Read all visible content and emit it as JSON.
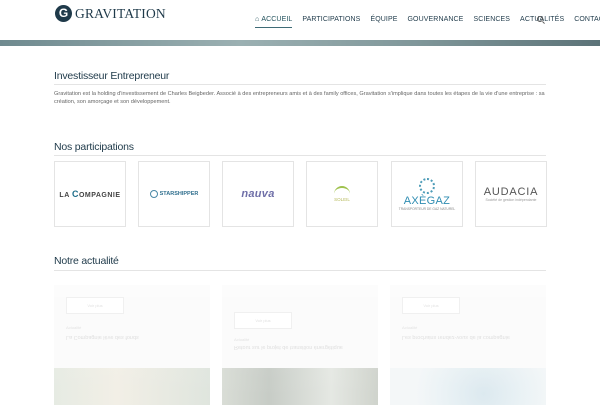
{
  "brand": {
    "logo_letter": "G",
    "name": "GRAVITATION"
  },
  "nav": {
    "items": [
      {
        "label": "ACCUEIL",
        "active": true
      },
      {
        "label": "PARTICIPATIONS"
      },
      {
        "label": "ÉQUIPE"
      },
      {
        "label": "GOUVERNANCE"
      },
      {
        "label": "SCIENCES"
      },
      {
        "label": "ACTUALITÉS"
      },
      {
        "label": "CONTACT"
      }
    ]
  },
  "intro": {
    "title": "Investisseur Entrepreneur",
    "text": "Gravitation est la holding d'investissement de Charles Beigbeder. Associé à des entrepreneurs amis et à des family offices, Gravitation s'implique dans toutes les étapes de la vie d'une entreprise : sa création, son amorçage et son développement."
  },
  "participations": {
    "title": "Nos participations",
    "partners": [
      {
        "name": "LA COMPAGNIE",
        "prefix": "LA ",
        "big": "C",
        "rest": "OMPAGNIE"
      },
      {
        "name": "STARSHIPPER"
      },
      {
        "name": "nauva"
      },
      {
        "name": "SOLEIL"
      },
      {
        "name": "AXÈGAZ",
        "sub": "TRANSPORTEUR DE GAZ NATUREL"
      },
      {
        "name": "AUDACIA",
        "sub": "Société de gestion indépendante"
      }
    ]
  },
  "news": {
    "title": "Notre actualité",
    "badge": "Voir plus",
    "items": [
      {
        "meta": "Actualité",
        "title": "La Compagnie lève des fonds"
      },
      {
        "meta": "Actualité",
        "title": "Retour sur le projet de transition énergétique"
      },
      {
        "meta": "Actualité",
        "title": "Les prochains rendez-vous de la compagnie"
      }
    ]
  },
  "colors": {
    "primary": "#1f3a4a",
    "accent": "#3e6b76"
  },
  "icons": {
    "home": "home-icon",
    "search": "search-icon"
  }
}
